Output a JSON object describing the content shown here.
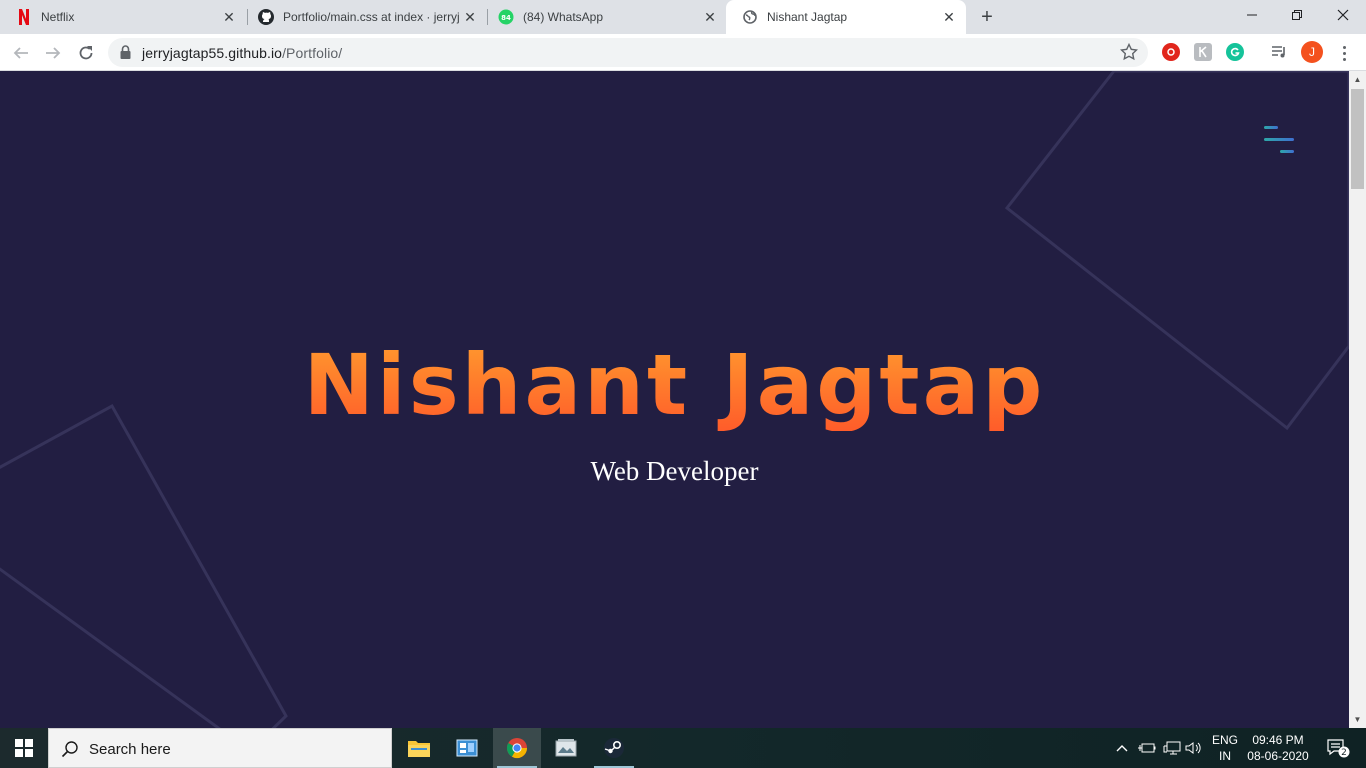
{
  "browser": {
    "tabs": [
      {
        "title": "Netflix",
        "favicon": "netflix-icon",
        "active": false
      },
      {
        "title": "Portfolio/main.css at index · jerryj",
        "favicon": "github-icon",
        "active": false
      },
      {
        "title": "(84) WhatsApp",
        "favicon": "whatsapp-icon",
        "active": false,
        "badge": "84"
      },
      {
        "title": "Nishant Jagtap",
        "favicon": "globe-icon",
        "active": true
      }
    ],
    "address": {
      "host": "jerryjagtap55.github.io",
      "path": "/Portfolio/"
    },
    "profile_initial": "J"
  },
  "page": {
    "name": "Nishant Jagtap",
    "role": "Web Developer",
    "colors": {
      "background": "#221e42",
      "name_gradient_top": "#ff9a2e",
      "name_gradient_bottom": "#ff5c2a",
      "menu_accent": "#2ea8a8"
    }
  },
  "taskbar": {
    "search_placeholder": "Search here",
    "language": {
      "line1": "ENG",
      "line2": "IN"
    },
    "time": "09:46 PM",
    "date": "08-06-2020",
    "notifications": "2"
  }
}
